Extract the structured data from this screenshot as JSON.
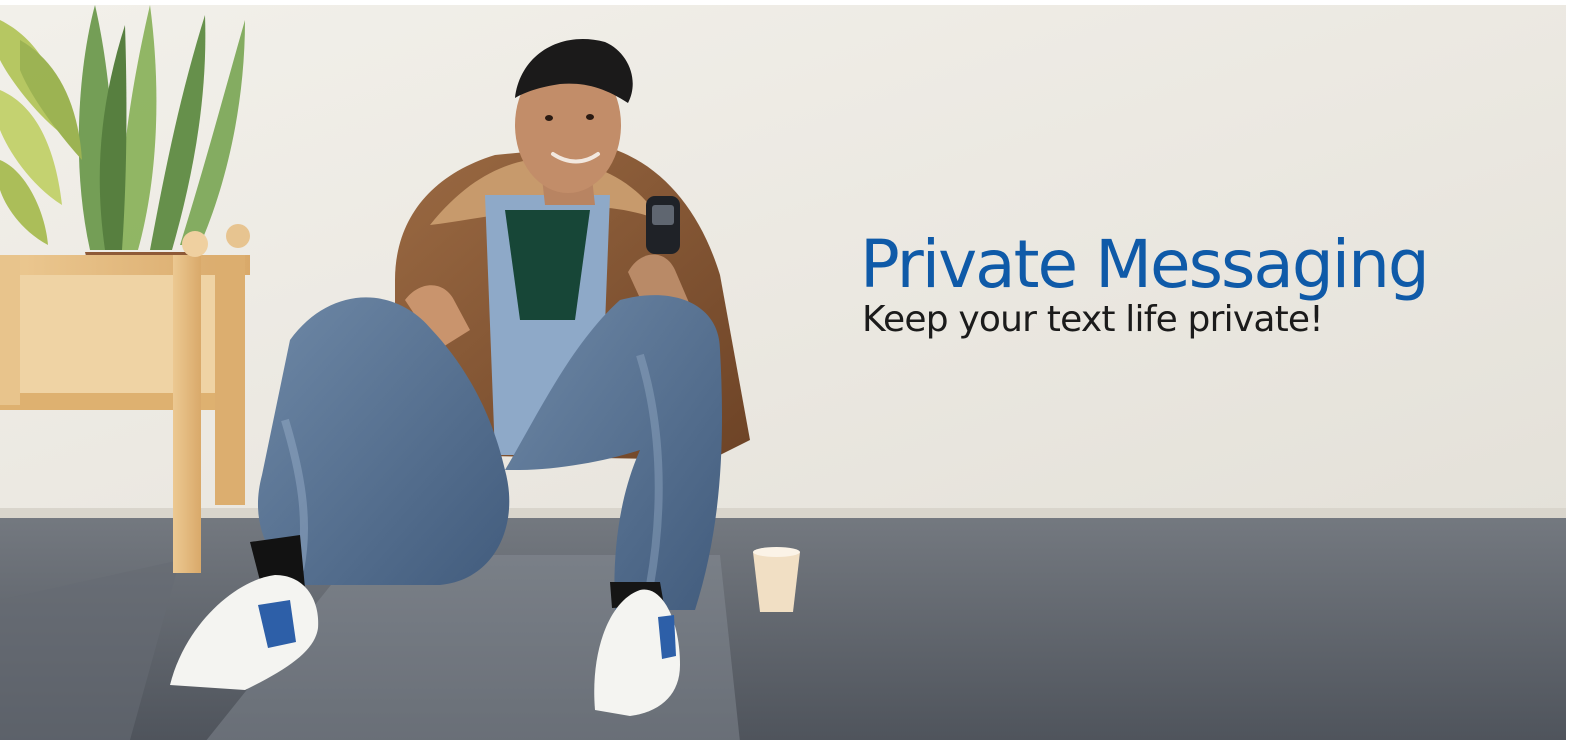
{
  "banner": {
    "title": "Private Messaging",
    "subtitle": "Keep your text life private!",
    "title_color": "#0f5aa8",
    "subtitle_color": "#1b1b1b"
  }
}
